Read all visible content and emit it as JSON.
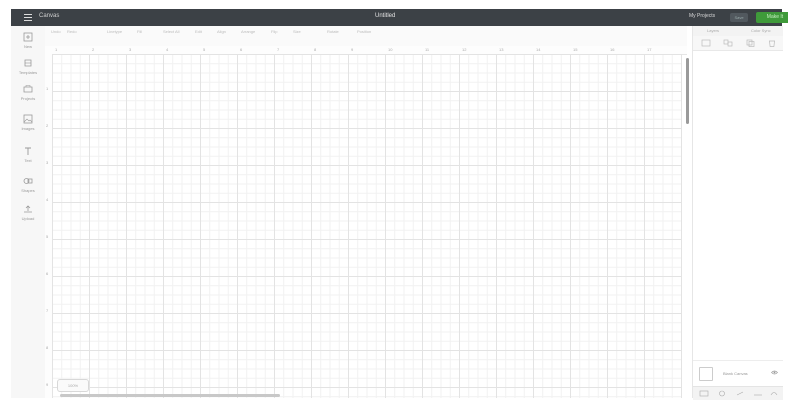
{
  "header": {
    "menu_icon": "hamburger-icon",
    "canvas_label": "Canvas",
    "doc_title": "Untitled",
    "account_label": "My Projects",
    "save_label": "Save",
    "make_label": "Make It"
  },
  "leftbar": {
    "tools": [
      {
        "icon": "new-icon",
        "label": "New"
      },
      {
        "icon": "templates-icon",
        "label": "Templates"
      },
      {
        "icon": "projects-icon",
        "label": "Projects"
      },
      {
        "icon": "images-icon",
        "label": "Images"
      },
      {
        "icon": "text-icon",
        "label": "Text"
      },
      {
        "icon": "shapes-icon",
        "label": "Shapes"
      },
      {
        "icon": "upload-icon",
        "label": "Upload"
      }
    ]
  },
  "optionbar": {
    "items": [
      "Undo",
      "Redo",
      "Linetype",
      "Fill",
      "Select All",
      "Edit",
      "Align",
      "Arrange",
      "Flip",
      "Size",
      "Rotate",
      "Position"
    ]
  },
  "ruler": {
    "h_numbers": [
      "1",
      "2",
      "3",
      "4",
      "5",
      "6",
      "7",
      "8",
      "9",
      "10",
      "11",
      "12",
      "13",
      "14",
      "15",
      "16",
      "17"
    ],
    "v_numbers": [
      "1",
      "2",
      "3",
      "4",
      "5",
      "6",
      "7",
      "8",
      "9"
    ]
  },
  "canvas": {
    "zoom_label": "100%"
  },
  "rightpanel": {
    "tabs": [
      "Layers",
      "Color Sync"
    ],
    "actions": [
      "Group",
      "Ungroup",
      "Duplicate",
      "Delete"
    ],
    "canvas_option": "Blank Canvas",
    "footer_buttons": [
      "Slice",
      "Weld",
      "Attach",
      "Flatten",
      "Contour"
    ]
  },
  "colors": {
    "header_bg": "#3c4146",
    "make_button": "#3f9a3a",
    "grid_line": "#e3e3e3"
  }
}
